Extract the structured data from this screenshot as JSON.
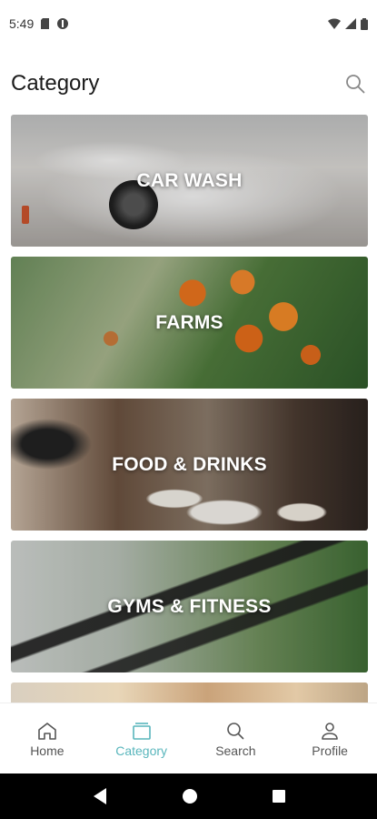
{
  "status_bar": {
    "time": "5:49",
    "left_icons": [
      "sd-card-icon",
      "app-notification-icon"
    ],
    "right_icons": [
      "wifi-icon",
      "cell-signal-icon",
      "battery-icon"
    ]
  },
  "header": {
    "title": "Category",
    "search_icon": "search-icon"
  },
  "categories": [
    {
      "label": "CAR WASH"
    },
    {
      "label": "FARMS"
    },
    {
      "label": "FOOD & DRINKS"
    },
    {
      "label": "GYMS & FITNESS"
    },
    {
      "label": ""
    }
  ],
  "bottom_nav": {
    "items": [
      {
        "label": "Home",
        "icon": "home-icon"
      },
      {
        "label": "Category",
        "icon": "category-icon"
      },
      {
        "label": "Search",
        "icon": "search-icon"
      },
      {
        "label": "Profile",
        "icon": "profile-icon"
      }
    ],
    "active_index": 1,
    "accent_color": "#59b6bc"
  },
  "system_nav": {
    "buttons": [
      "back-icon",
      "home-circle-icon",
      "recents-icon"
    ]
  }
}
